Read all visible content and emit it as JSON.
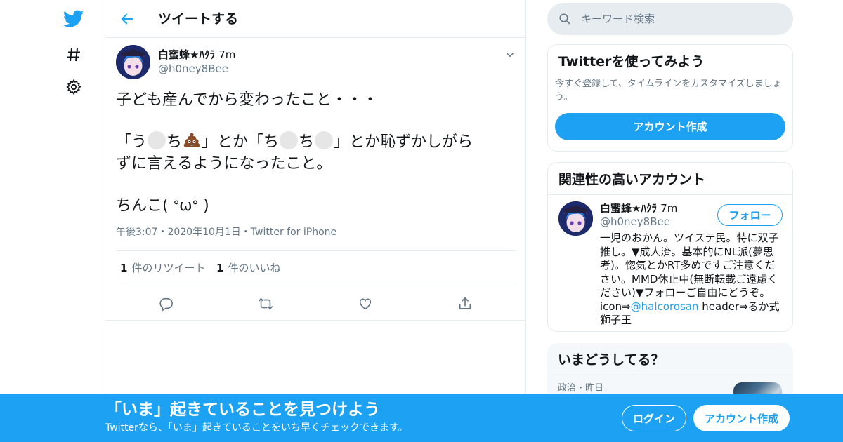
{
  "colors": {
    "accent": "#1da1f2",
    "text_primary": "#14171a",
    "text_secondary": "#657786",
    "border": "#e6ecf0"
  },
  "nav": {
    "items": [
      {
        "icon": "twitter-bird-icon"
      },
      {
        "icon": "hashtag-icon"
      },
      {
        "icon": "gear-icon"
      }
    ]
  },
  "header": {
    "back_icon": "arrow-left-icon",
    "title": "ツイートする"
  },
  "tweet": {
    "author_name": "白蜜蜂★ﾊｸﾗ",
    "time_ago": "7m",
    "author_handle": "@h0ney8Bee",
    "text_line1": "子ども産んでから変わったこと・・・",
    "text_line2_a": "「う",
    "text_line2_b": "ち",
    "text_line2_c": "」とか「ち",
    "text_line2_d": "ち",
    "text_line2_e": "」とか恥ずかしがら",
    "text_line3": "ずに言えるようになったこと。",
    "text_line4": "ちんこ( ᐤωᐤ )",
    "timestamp": "午後3:07・2020年10月1日・Twitter for iPhone",
    "retweet_count": "1",
    "retweet_label": "件のリツイート",
    "like_count": "1",
    "like_label": "件のいいね",
    "actions": [
      "reply-icon",
      "retweet-icon",
      "heart-icon",
      "share-icon"
    ]
  },
  "search": {
    "placeholder": "キーワード検索"
  },
  "signup_card": {
    "title": "Twitterを使ってみよう",
    "description": "今すぐ登録して、タイムラインをカスタマイズしましょう。",
    "button": "アカウント作成"
  },
  "related_card": {
    "title": "関連性の高いアカウント",
    "name": "白蜜蜂★ﾊｸﾗ",
    "time_ago": "7m",
    "handle": "@h0ney8Bee",
    "follow_button": "フォロー",
    "bio_before": "一児のおかん。ツイステ民。特に双子推し。▼成人済。基本的にNL派(夢思考)。惚気とかRT多めですご注意ください。MMD休止中(無断転載ご遠慮ください)▼フォローご自由にどうぞ。icon⇒",
    "bio_link": "@halcorosan",
    "bio_after": " header⇒るか式獅子王"
  },
  "trends_card": {
    "title": "いまどうしてる？",
    "first_meta": "政治・昨日"
  },
  "bottom_bar": {
    "title": "「いま」起きていることを見つけよう",
    "subtitle": "Twitterなら、「いま」起きていることをいち早くチェックできます。",
    "login_button": "ログイン",
    "signup_button": "アカウント作成"
  }
}
